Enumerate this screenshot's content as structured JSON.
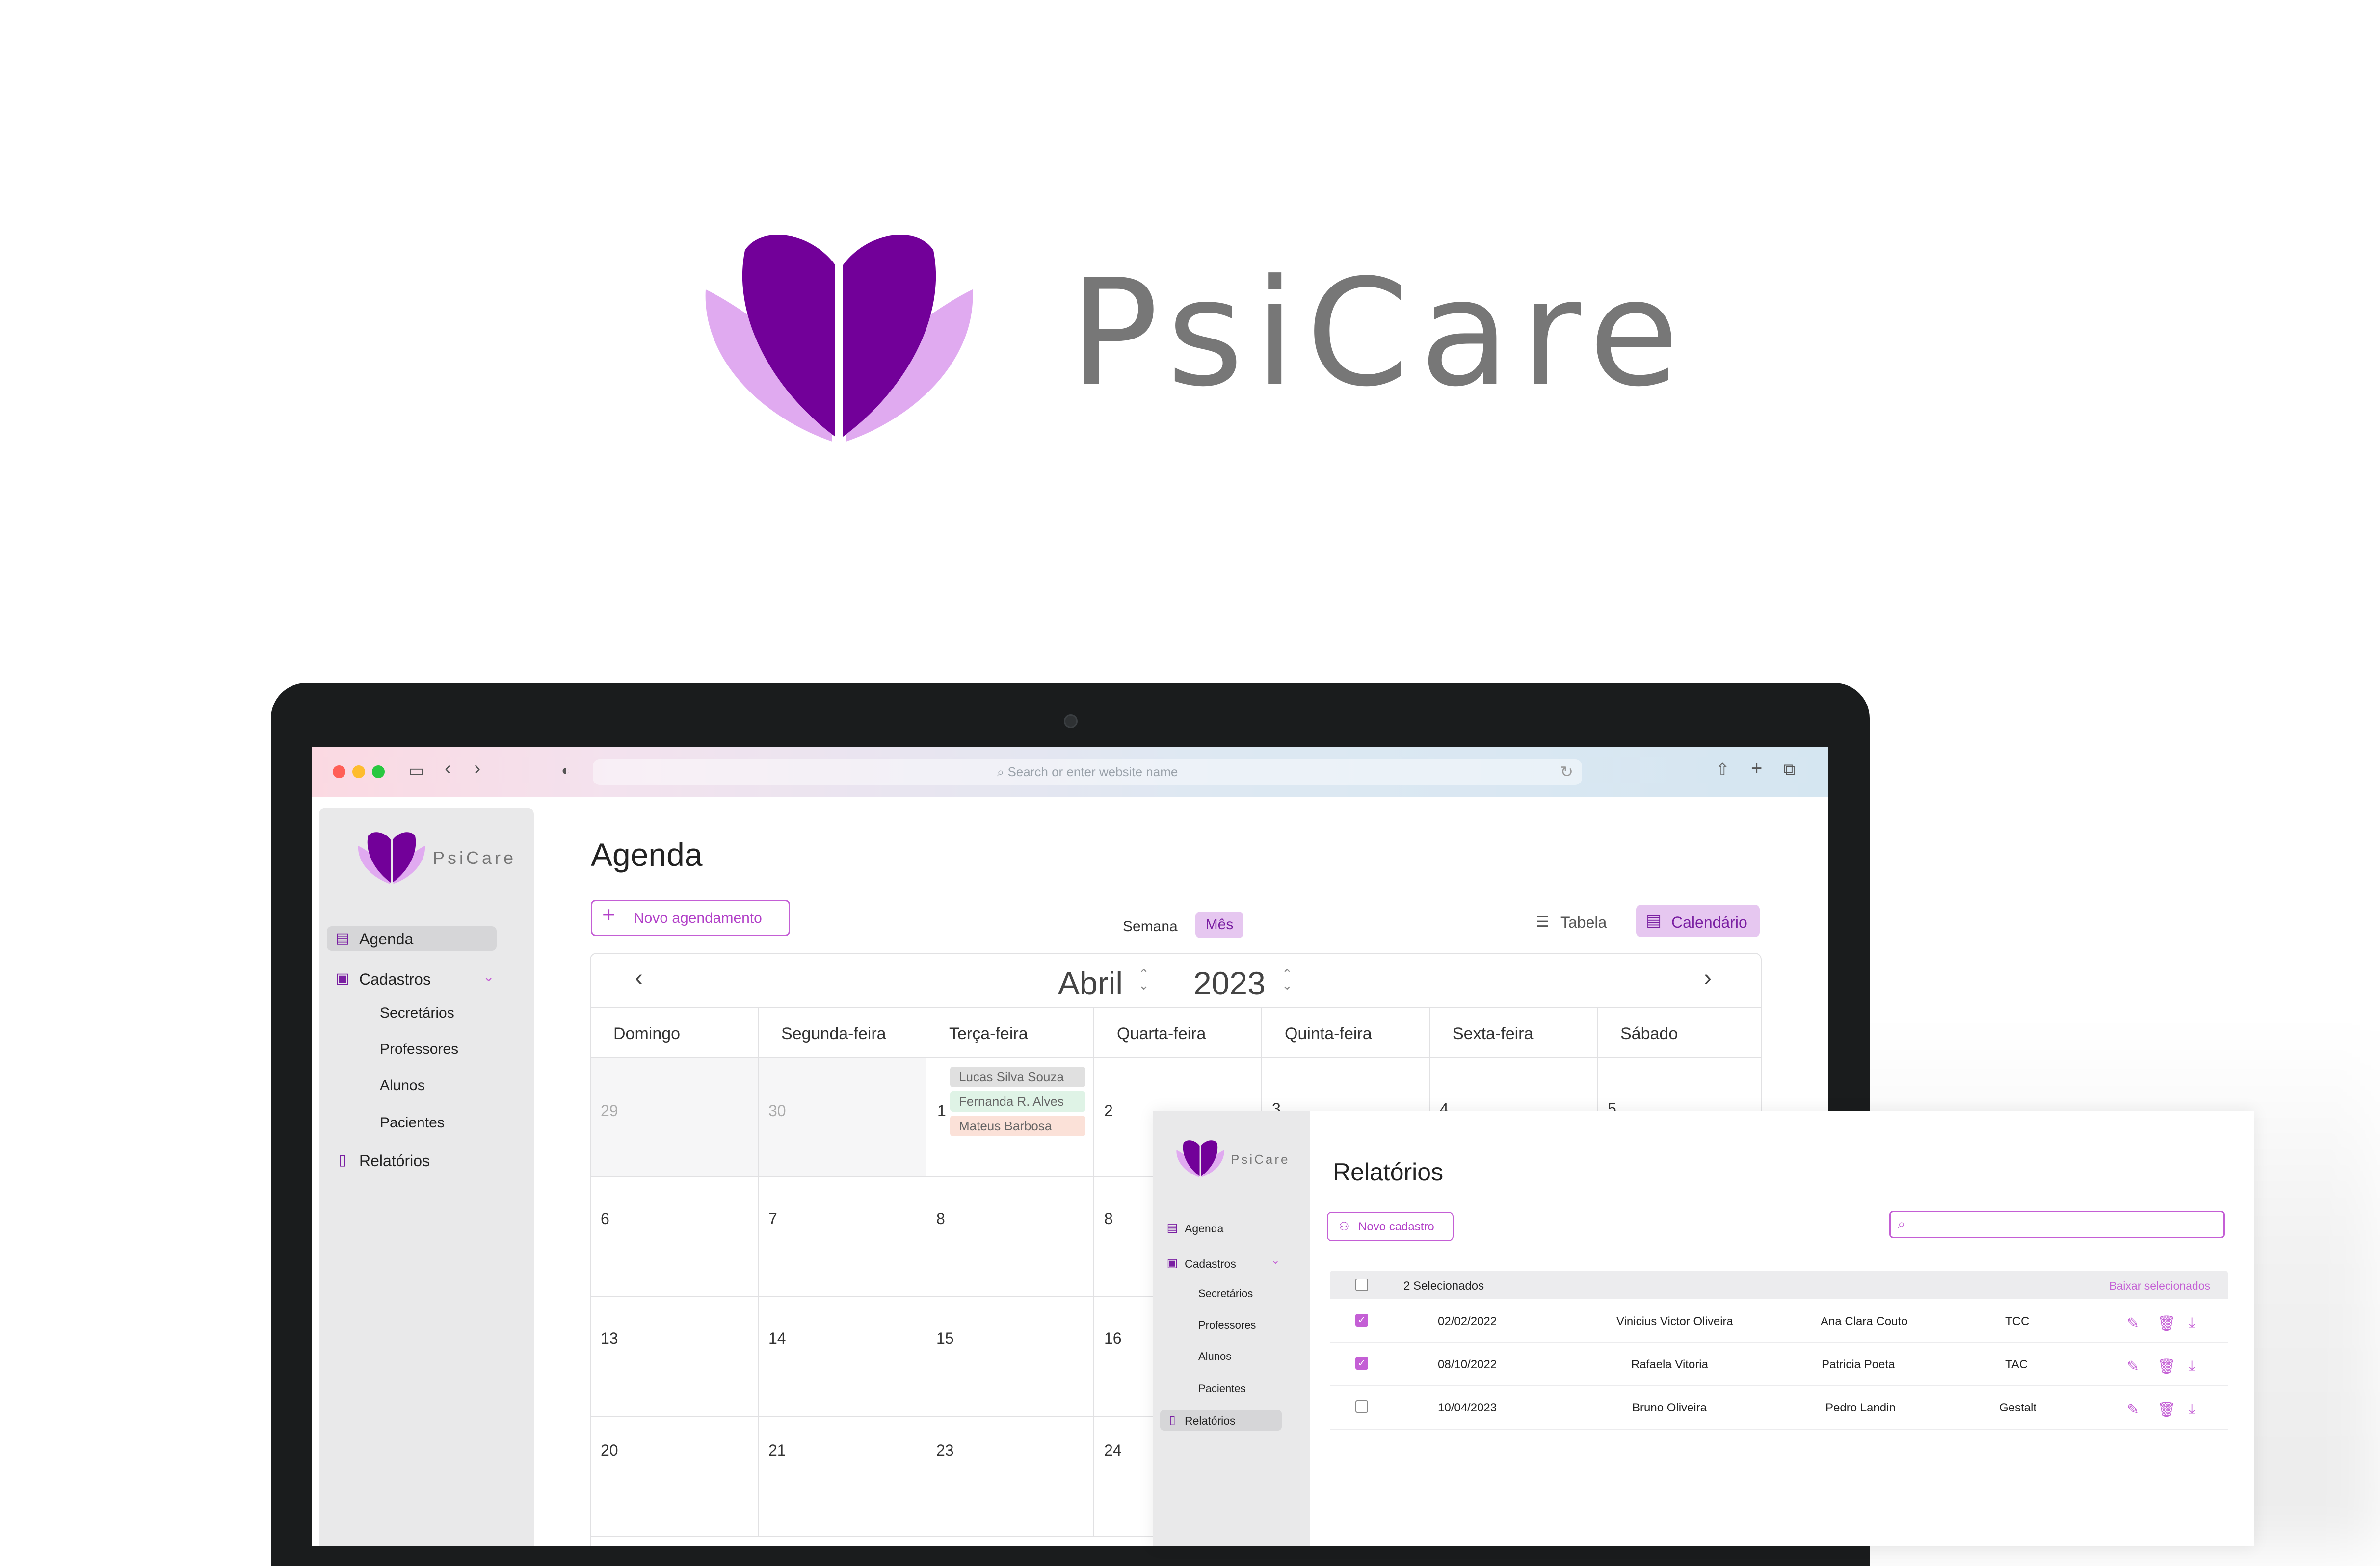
{
  "hero": {
    "brand": "PsiCare"
  },
  "colors": {
    "brand_dark": "#720099",
    "brand_light": "#e0aaf0",
    "accent": "#c45fd5",
    "brand_text": "#777777"
  },
  "browser": {
    "url_placeholder": "Search or enter website name"
  },
  "agenda_app": {
    "brand": "PsiCare",
    "nav": [
      {
        "label": "Agenda",
        "icon": "calendar-icon",
        "active": true
      },
      {
        "label": "Cadastros",
        "icon": "contacts-icon",
        "active": false
      },
      {
        "label": "Relatórios",
        "icon": "clipboard-icon",
        "active": false
      }
    ],
    "subnav": [
      "Secretários",
      "Professores",
      "Alunos",
      "Pacientes"
    ],
    "title": "Agenda",
    "new_button": "Novo agendamento",
    "view_week": "Semana",
    "view_month": "Mês",
    "mode_table": "Tabela",
    "mode_calendar": "Calendário",
    "month": "Abril",
    "year": "2023",
    "weekdays": [
      "Domingo",
      "Segunda-feira",
      "Terça-feira",
      "Quarta-feira",
      "Quinta-feira",
      "Sexta-feira",
      "Sábado"
    ],
    "weeks": [
      [
        "29",
        "30",
        "1",
        "2",
        "3",
        "4",
        "5"
      ],
      [
        "6",
        "7",
        "8",
        "8",
        "",
        "",
        ""
      ],
      [
        "13",
        "14",
        "15",
        "16",
        "",
        "",
        ""
      ],
      [
        "20",
        "21",
        "23",
        "24",
        "",
        "",
        ""
      ]
    ],
    "events": [
      {
        "name": "Lucas Silva Souza",
        "color": "#e0e0e0"
      },
      {
        "name": "Fernanda R. Alves",
        "color": "#dff3e6"
      },
      {
        "name": "Mateus Barbosa",
        "color": "#fbe1d8"
      }
    ]
  },
  "reports_app": {
    "brand": "PsiCare",
    "nav": [
      {
        "label": "Agenda",
        "icon": "calendar-icon",
        "active": false
      },
      {
        "label": "Cadastros",
        "icon": "contacts-icon",
        "active": false
      },
      {
        "label": "Relatórios",
        "icon": "clipboard-icon",
        "active": true
      }
    ],
    "subnav": [
      "Secretários",
      "Professores",
      "Alunos",
      "Pacientes"
    ],
    "title": "Relatórios",
    "new_button": "Novo cadastro",
    "selected_label": "2 Selecionados",
    "download_selected": "Baixar selecionados",
    "rows": [
      {
        "checked": true,
        "date": "02/02/2022",
        "patient": "Vinicius Victor Oliveira",
        "professional": "Ana Clara Couto",
        "type": "TCC"
      },
      {
        "checked": true,
        "date": "08/10/2022",
        "patient": "Rafaela Vitoria",
        "professional": "Patricia Poeta",
        "type": "TAC"
      },
      {
        "checked": false,
        "date": "10/04/2023",
        "patient": "Bruno Oliveira",
        "professional": "Pedro Landin",
        "type": "Gestalt"
      }
    ]
  }
}
